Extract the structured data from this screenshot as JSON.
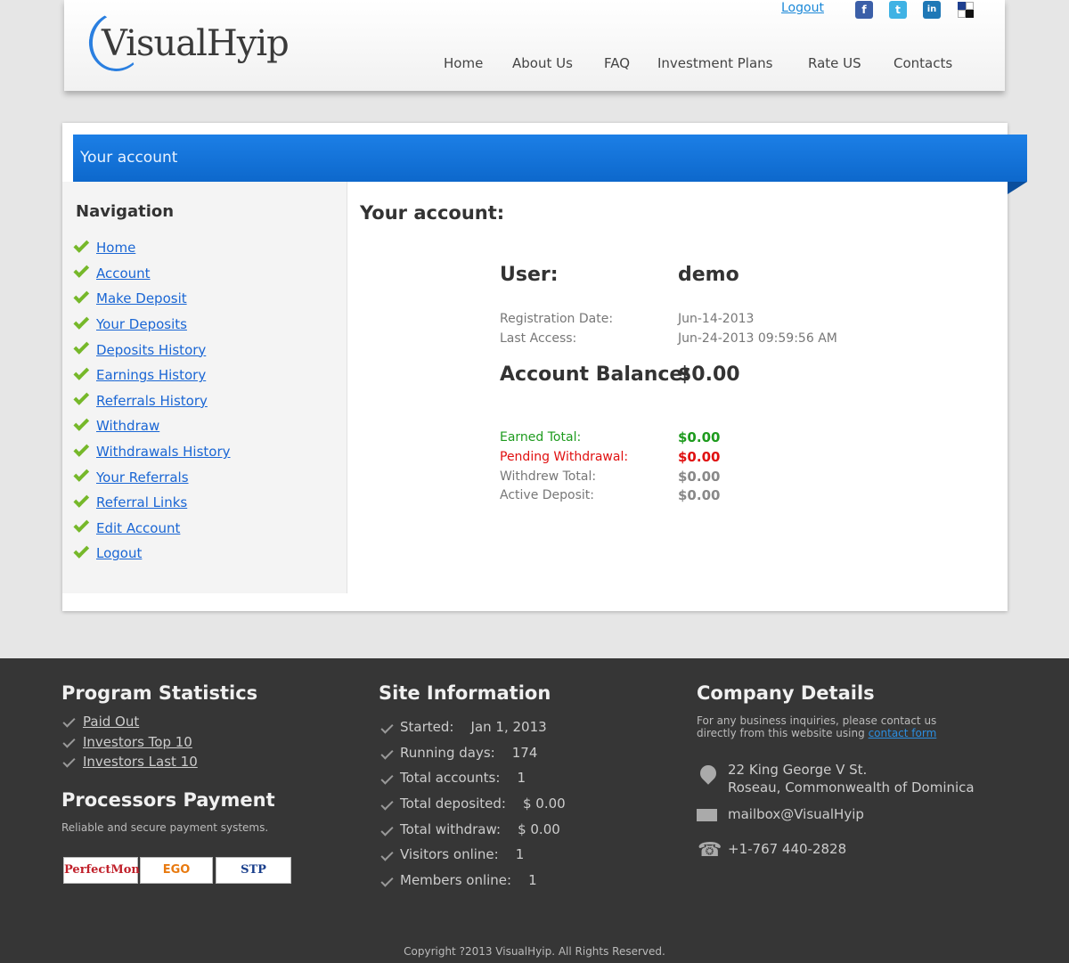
{
  "header": {
    "logo": "VisualHyip",
    "logout": "Logout",
    "social": [
      "f",
      "t",
      "in"
    ],
    "nav": [
      "Home",
      "About Us",
      "FAQ",
      "Investment Plans",
      "Rate US",
      "Contacts"
    ]
  },
  "ribbon": {
    "title": "Your account"
  },
  "sidebar": {
    "title": "Navigation",
    "items": [
      "Home",
      "Account",
      "Make Deposit",
      "Your Deposits",
      "Deposits History",
      "Earnings History",
      "Referrals History",
      "Withdraw",
      "Withdrawals History",
      "Your Referrals",
      "Referral Links",
      "Edit Account",
      "Logout"
    ]
  },
  "account": {
    "heading": "Your account:",
    "user_label": "User:",
    "user_value": "demo",
    "reg_label": "Registration Date:",
    "reg_value": "Jun-14-2013",
    "access_label": "Last Access:",
    "access_value": "Jun-24-2013 09:59:56 AM",
    "balance_label": "Account Balance:",
    "balance_value": "$0.00",
    "earned_label": "Earned Total:",
    "earned_value": "$0.00",
    "pending_label": "Pending Withdrawal:",
    "pending_value": "$0.00",
    "withdrew_label": "Withdrew Total:",
    "withdrew_value": "$0.00",
    "active_label": "Active Deposit:",
    "active_value": "$0.00",
    "colors": {
      "earned": "#1e9b1e",
      "pending": "#e01010",
      "neutral": "#888888"
    }
  },
  "footer": {
    "stats_title": "Program Statistics",
    "stats_links": [
      "Paid Out",
      "Investors Top 10",
      "Investors Last 10"
    ],
    "proc_title": "Processors Payment",
    "proc_text": "Reliable and secure payment systems.",
    "processors": [
      "PerfectMoney",
      "EGO",
      "STP"
    ],
    "site_title": "Site Information",
    "site_info": [
      "Started:    Jan 1, 2013",
      "Running days:    174",
      "Total accounts:    1",
      "Total deposited:    $ 0.00",
      "Total withdraw:    $ 0.00",
      "Visitors online:    1",
      "Members online:    1"
    ],
    "company_title": "Company Details",
    "company_text_1": "For any business inquiries, please contact us",
    "company_text_2": "directly from this website using",
    "company_link": "contact form",
    "address_1": "22 King George V St.",
    "address_2": "Roseau, Commonwealth of Dominica",
    "email": "mailbox@VisualHyip",
    "phone": "+1-767 440-2828",
    "copyright": "Copyright ?2013 VisualHyip. All Rights Reserved."
  }
}
